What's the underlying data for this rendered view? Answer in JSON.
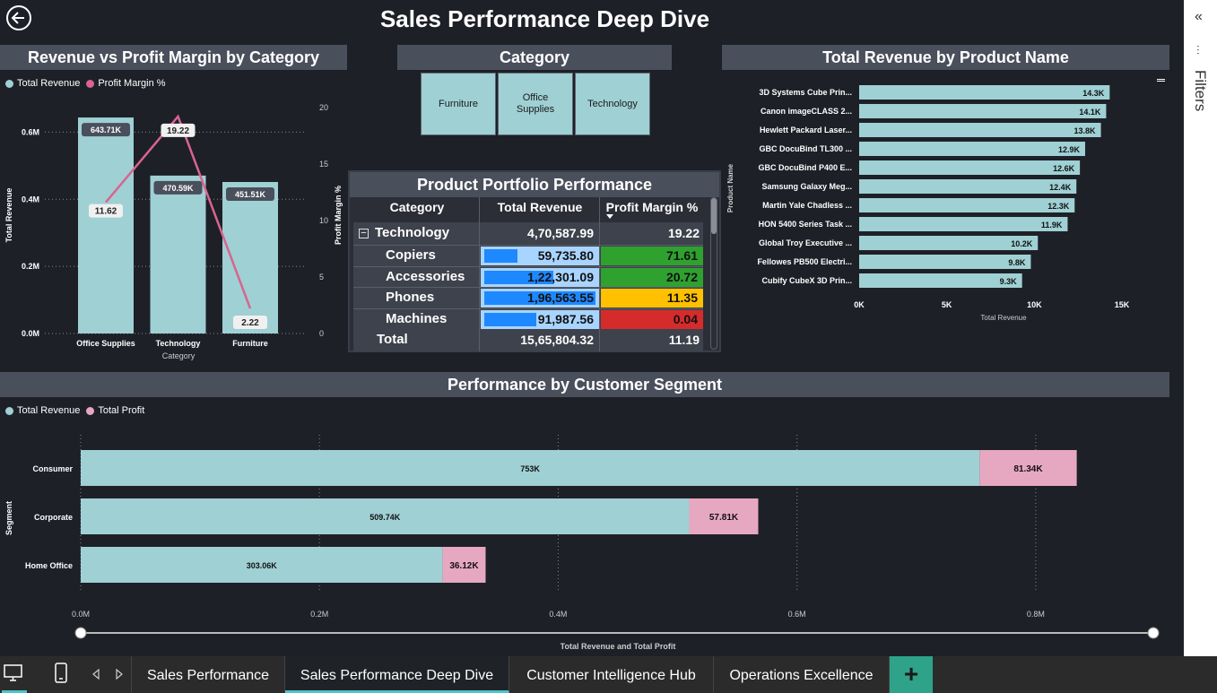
{
  "page": {
    "title": "Sales Performance Deep Dive"
  },
  "chart1": {
    "header": "Revenue vs Profit Margin by Category",
    "legend": [
      {
        "label": "Total Revenue",
        "color": "#9fd0d4"
      },
      {
        "label": "Profit Margin %",
        "color": "#d9648f"
      }
    ],
    "y_left_label": "Total Revenue",
    "y_right_label": "Profit Margin %",
    "x_label": "Category",
    "y_left_ticks": [
      "0.0M",
      "0.2M",
      "0.4M",
      "0.6M"
    ],
    "y_right_ticks": [
      "0",
      "5",
      "10",
      "15",
      "20"
    ]
  },
  "slicer": {
    "header": "Category",
    "options": [
      "Furniture",
      "Office Supplies",
      "Technology"
    ]
  },
  "table": {
    "title": "Product Portfolio Performance",
    "columns": [
      "Category",
      "Total Revenue",
      "Profit Margin %"
    ],
    "group": {
      "label": "Technology",
      "revenue": "4,70,587.99",
      "margin": "19.22",
      "expand_glyph": "−"
    },
    "rows": [
      {
        "label": "Copiers",
        "revenue": "59,735.80",
        "revenue_fraction": 0.3,
        "margin": "71.61",
        "margin_color": "#2ea12e"
      },
      {
        "label": "Accessories",
        "revenue": "1,22,301.09",
        "revenue_fraction": 0.62,
        "margin": "20.72",
        "margin_color": "#2ea12e"
      },
      {
        "label": "Phones",
        "revenue": "1,96,563.55",
        "revenue_fraction": 1.0,
        "margin": "11.35",
        "margin_color": "#ffc000"
      },
      {
        "label": "Machines",
        "revenue": "91,987.56",
        "revenue_fraction": 0.47,
        "margin": "0.04",
        "margin_color": "#d62b2b"
      }
    ],
    "total": {
      "label": "Total",
      "revenue": "15,65,804.32",
      "margin": "11.19"
    }
  },
  "chart3": {
    "header": "Total Revenue by Product Name",
    "y_label": "Product Name",
    "x_label": "Total Revenue",
    "x_ticks": [
      "0K",
      "5K",
      "10K",
      "15K"
    ]
  },
  "chart4": {
    "header": "Performance by Customer Segment",
    "legend": [
      {
        "label": "Total Revenue",
        "color": "#9fd0d4"
      },
      {
        "label": "Total Profit",
        "color": "#e6a8c0"
      }
    ],
    "y_label": "Segment",
    "x_label": "Total Revenue and Total Profit",
    "x_ticks": [
      "0.0M",
      "0.2M",
      "0.4M",
      "0.6M",
      "0.8M"
    ]
  },
  "chart_data": [
    {
      "type": "bar",
      "title": "Revenue vs Profit Margin by Category",
      "categories": [
        "Office Supplies",
        "Technology",
        "Furniture"
      ],
      "series": [
        {
          "name": "Total Revenue",
          "kind": "bar",
          "values": [
            643710,
            470590,
            451510
          ],
          "labels": [
            "643.71K",
            "470.59K",
            "451.51K"
          ]
        },
        {
          "name": "Profit Margin %",
          "kind": "line",
          "values": [
            11.62,
            19.22,
            2.22
          ],
          "labels": [
            "11.62",
            "19.22",
            "2.22"
          ]
        }
      ],
      "xlabel": "Category",
      "ylabel": "Total Revenue",
      "y2label": "Profit Margin %",
      "ylim": [
        0,
        0.7
      ],
      "y2lim": [
        0,
        20.8
      ]
    },
    {
      "type": "bar",
      "title": "Total Revenue by Product Name",
      "orientation": "horizontal",
      "categories": [
        "3D Systems Cube Prin...",
        "Canon imageCLASS 2...",
        "Hewlett Packard Laser...",
        "GBC DocuBind TL300 ...",
        "GBC DocuBind P400 E...",
        "Samsung Galaxy Meg...",
        "Martin Yale Chadless ...",
        "HON 5400 Series Task ...",
        "Global Troy Executive ...",
        "Fellowes PB500 Electri...",
        "Cubify CubeX 3D Prin..."
      ],
      "values": [
        14.3,
        14.1,
        13.8,
        12.9,
        12.6,
        12.4,
        12.3,
        11.9,
        10.2,
        9.8,
        9.3
      ],
      "labels": [
        "14.3K",
        "14.1K",
        "13.8K",
        "12.9K",
        "12.6K",
        "12.4K",
        "12.3K",
        "11.9K",
        "10.2K",
        "9.8K",
        "9.3K"
      ],
      "xlabel": "Total Revenue",
      "ylabel": "Product Name",
      "xlim": [
        0,
        15
      ]
    },
    {
      "type": "bar",
      "title": "Performance by Customer Segment",
      "orientation": "horizontal",
      "stacked": true,
      "categories": [
        "Consumer",
        "Corporate",
        "Home Office"
      ],
      "series": [
        {
          "name": "Total Revenue",
          "values": [
            0.753,
            0.50974,
            0.30306
          ],
          "labels": [
            "753K",
            "509.74K",
            "303.06K"
          ]
        },
        {
          "name": "Total Profit",
          "values": [
            0.08134,
            0.05781,
            0.03612
          ],
          "labels": [
            "81.34K",
            "57.81K",
            "36.12K"
          ]
        }
      ],
      "xlabel": "Total Revenue and Total Profit",
      "ylabel": "Segment",
      "xlim": [
        0,
        0.9
      ]
    }
  ],
  "tabs": [
    {
      "label": "Sales Performance",
      "active": false
    },
    {
      "label": "Sales Performance Deep Dive",
      "active": true
    },
    {
      "label": "Customer Intelligence Hub",
      "active": false
    },
    {
      "label": "Operations Excellence",
      "active": false
    }
  ],
  "add_tab_glyph": "+",
  "filters": {
    "label": "Filters",
    "collapse_glyph": "«",
    "funnel_glyph": "⫶"
  }
}
